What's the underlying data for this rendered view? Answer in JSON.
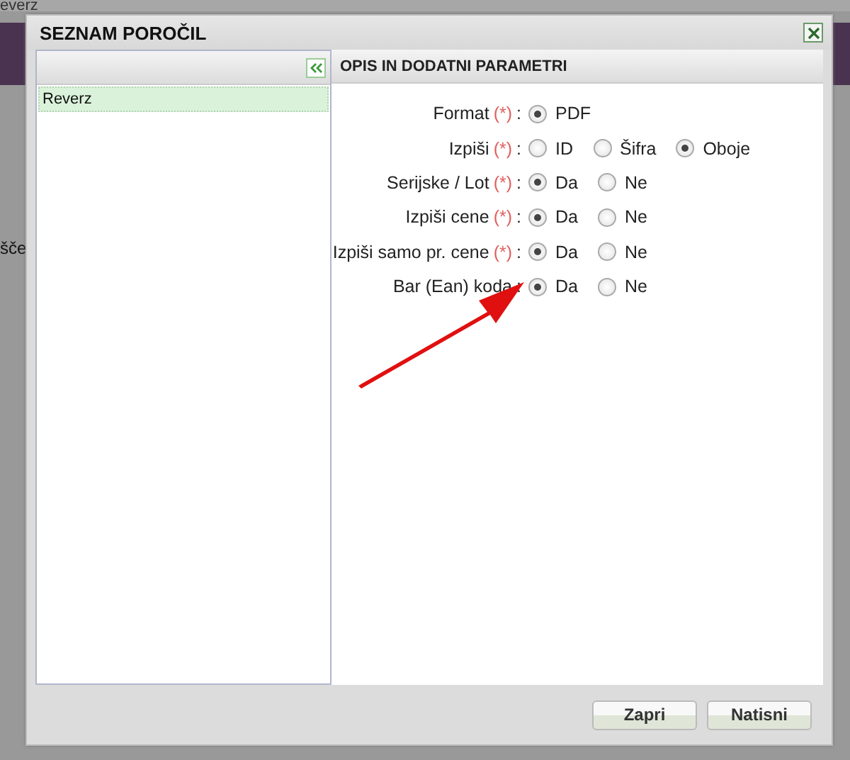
{
  "background": {
    "texts": [
      "everz",
      "šče"
    ]
  },
  "dialog": {
    "title": "SEZNAM POROČIL",
    "left_panel": {
      "items": [
        {
          "label": "Reverz",
          "selected": true
        }
      ]
    },
    "right_panel": {
      "title": "OPIS IN DODATNI PARAMETRI",
      "fields": [
        {
          "label": "Format",
          "required_mark": "(*)",
          "separator": ":",
          "options": [
            {
              "label": "PDF",
              "selected": true
            }
          ]
        },
        {
          "label": "Izpiši",
          "required_mark": "(*)",
          "separator": ":",
          "options": [
            {
              "label": "ID",
              "selected": false
            },
            {
              "label": "Šifra",
              "selected": false
            },
            {
              "label": "Oboje",
              "selected": true
            }
          ]
        },
        {
          "label": "Serijske / Lot",
          "required_mark": "(*)",
          "separator": ":",
          "options": [
            {
              "label": "Da",
              "selected": true
            },
            {
              "label": "Ne",
              "selected": false
            }
          ]
        },
        {
          "label": "Izpiši cene",
          "required_mark": "(*)",
          "separator": ":",
          "options": [
            {
              "label": "Da",
              "selected": true
            },
            {
              "label": "Ne",
              "selected": false
            }
          ]
        },
        {
          "label": "Izpiši samo pr. cene",
          "required_mark": "(*)",
          "separator": ":",
          "options": [
            {
              "label": "Da",
              "selected": true
            },
            {
              "label": "Ne",
              "selected": false
            }
          ]
        },
        {
          "label": "Bar (Ean) koda",
          "separator": ":",
          "options": [
            {
              "label": "Da",
              "selected": true
            },
            {
              "label": "Ne",
              "selected": false
            }
          ]
        }
      ]
    },
    "buttons": [
      "Zapri",
      "Natisni"
    ]
  }
}
